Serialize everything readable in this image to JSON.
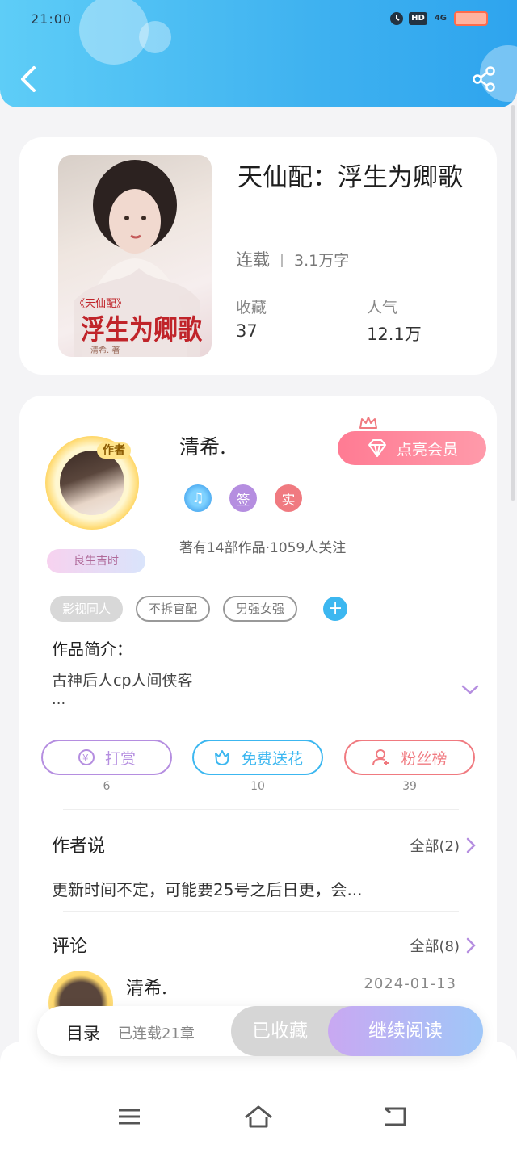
{
  "status_bar": {
    "time": "21:00",
    "hd": "HD",
    "network": "4G"
  },
  "book": {
    "title": "天仙配：浮生为卿歌",
    "status": "连载",
    "words": "3.1万字",
    "collect_label": "收藏",
    "collect_value": "37",
    "popularity_label": "人气",
    "popularity_value": "12.1万",
    "cover_text_series": "《天仙配》",
    "cover_text_main": "浮生为卿歌",
    "cover_text_author": "清希. 著"
  },
  "author": {
    "badge": "作者",
    "motto": "良生吉时",
    "name": "清希.",
    "vip_button": "点亮会员",
    "badge_sign": "签",
    "badge_real": "实",
    "info": "著有14部作品·1059人关注",
    "tags": [
      "影视同人",
      "不拆官配",
      "男强女强"
    ],
    "intro_label": "作品简介：",
    "intro_text": "古神后人cp人间侠客",
    "intro_ellipsis": "..."
  },
  "actions": [
    {
      "label": "打赏",
      "count": "6",
      "color": "#b58ee0"
    },
    {
      "label": "免费送花",
      "count": "10",
      "color": "#3cb7f0"
    },
    {
      "label": "粉丝榜",
      "count": "39",
      "color": "#f07a80"
    }
  ],
  "author_says": {
    "title": "作者说",
    "more": "全部(2)",
    "text": "更新时间不定，可能要25号之后日更，会..."
  },
  "comments": {
    "title": "评论",
    "more": "全部(8)",
    "name": "清希.",
    "date": "2024-01-13"
  },
  "reading_bar": {
    "toc": "目录",
    "toc_info": "已连载21章",
    "faved": "已收藏",
    "continue": "继续阅读"
  },
  "colors": {
    "header": "#3fb2f0",
    "vip": "#ff7b93",
    "accent_blue": "#3cb7f0"
  }
}
